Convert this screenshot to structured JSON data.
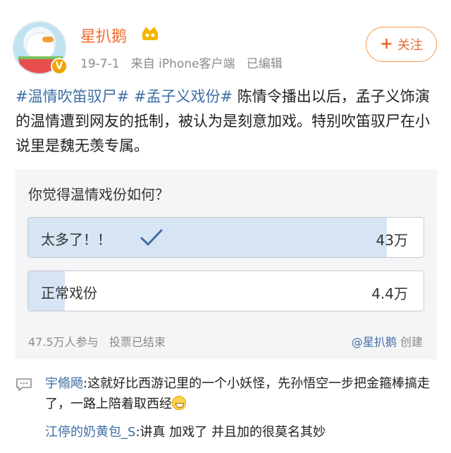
{
  "post": {
    "author": "星扒鹅",
    "date": "19-7-1",
    "source": "来自 iPhone客户端",
    "edited": "已编辑",
    "follow_label": "关注",
    "hashtags": [
      "#温情吹笛驭尸#",
      "#孟子义戏份#"
    ],
    "text": "陈情令播出以后，孟子义饰演的温情遭到网友的抵制，被认为是刻意加戏。特别吹笛驭尸在小说里是魏无羡专属。"
  },
  "poll": {
    "question": "你觉得温情戏份如何？",
    "options": [
      {
        "label": "太多了！！",
        "count": "43万",
        "share": 0.907,
        "selected": true
      },
      {
        "label": "正常戏份",
        "count": "4.4万",
        "share": 0.093,
        "selected": false
      }
    ],
    "participants": "47.5万人参与",
    "status": "投票已结束",
    "creator": "@星扒鹅",
    "creator_suffix": "创建"
  },
  "comments": [
    {
      "user": "宇翛飏",
      "text": ":这就好比西游记里的一个小妖怪，先孙悟空一步把金箍棒搞走了，一路上陪着取西经",
      "emoji": "grin-emoji"
    },
    {
      "user": "江停的奶黄包_S",
      "text": ":讲真  加戏了  并且加的很莫名其妙"
    }
  ],
  "colors": {
    "brand": "#f06b2f",
    "link": "#3f6ea5",
    "poll_fill": "#d6e4f3"
  }
}
